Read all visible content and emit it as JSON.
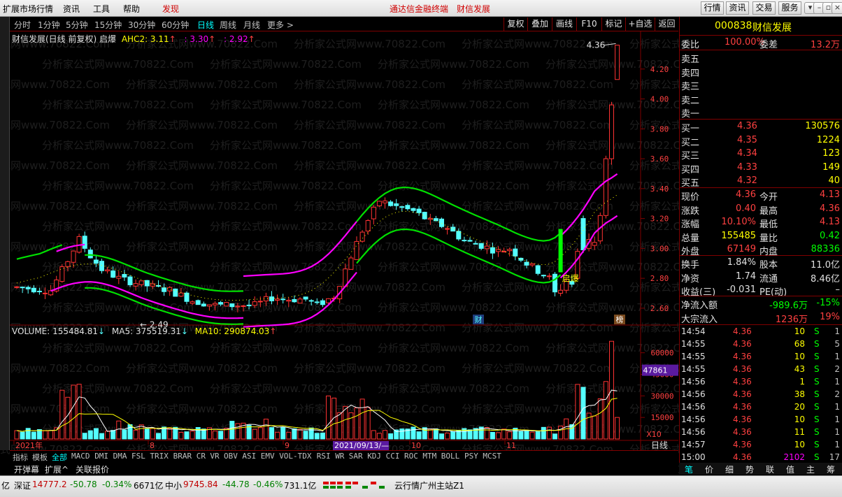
{
  "menu": {
    "items": [
      "扩展市场行情",
      "资讯",
      "工具",
      "帮助",
      "发现"
    ],
    "title_left": "通达信金融终端",
    "title_right": "财信发展",
    "right_buttons": [
      "行情",
      "资讯",
      "交易",
      "服务"
    ],
    "win_buttons": [
      "▾",
      "–",
      "▫",
      "×"
    ]
  },
  "periods": [
    "分时",
    "1分钟",
    "5分钟",
    "15分钟",
    "30分钟",
    "60分钟",
    "日线",
    "周线",
    "月线",
    "更多 >"
  ],
  "active_period": "日线",
  "toolbar": [
    "复权",
    "叠加",
    "画线",
    "F10",
    "标记",
    "+自选",
    "返回"
  ],
  "main_chart": {
    "stock_title": "财信发展(日线 前复权) 启爆",
    "ahc2_label": "AHC2: 3.11",
    "ahc2_b": ": 3.30",
    "ahc2_c": ": 2.92",
    "y_ticks": [
      "4.20",
      "4.00",
      "3.80",
      "3.60",
      "3.40",
      "3.20",
      "3.00",
      "2.80",
      "2.60"
    ],
    "high_label": "4.36",
    "low_label": "2.49",
    "signal_label": "启爆",
    "marker_cai": "财",
    "marker_bang": "榜"
  },
  "volume_chart": {
    "title": "VOLUME: 155484.81",
    "ma5": "MA5: 375519.31",
    "ma10": "MA10: 290874.03",
    "y_ticks": [
      "60000",
      "45000",
      "30000",
      "15000"
    ],
    "unit": "X10",
    "highlight": "47861"
  },
  "x_axis": {
    "labels": [
      "2021年",
      "8",
      "9",
      "2021/09/13/—",
      "10",
      "11"
    ],
    "right": "日线"
  },
  "indicator_tabs": [
    "指标",
    "模板",
    "全部",
    "MACD",
    "DMI",
    "DMA",
    "FSL",
    "TRIX",
    "BRAR",
    "CR",
    "VR",
    "OBV",
    "ASI",
    "EMV",
    "VOL-TDX",
    "RSI",
    "WR",
    "SAR",
    "KDJ",
    "CCI",
    "ROC",
    "MTM",
    "BOLL",
    "PSY",
    "MCST"
  ],
  "indicator_active": "全部",
  "bottom_tabs": [
    "开弹幕",
    "扩展^",
    "关联报价"
  ],
  "right_panel": {
    "code": "000838",
    "name": "财信发展",
    "weibi_label": "委比",
    "weibi": "100.00%",
    "weicha_label": "委差",
    "weicha": "13.2万",
    "sell_labels": [
      "卖五",
      "卖四",
      "卖三",
      "卖二",
      "卖一"
    ],
    "buy": [
      {
        "label": "买一",
        "price": "4.36",
        "vol": "130576"
      },
      {
        "label": "买二",
        "price": "4.35",
        "vol": "1224"
      },
      {
        "label": "买三",
        "price": "4.34",
        "vol": "123"
      },
      {
        "label": "买四",
        "price": "4.33",
        "vol": "149"
      },
      {
        "label": "买五",
        "price": "4.32",
        "vol": "40"
      }
    ],
    "stats": [
      {
        "l1": "现价",
        "v1": "4.36",
        "c1": "#ff4040",
        "l2": "今开",
        "v2": "4.13",
        "c2": "#ff4040"
      },
      {
        "l1": "涨跌",
        "v1": "0.40",
        "c1": "#ff4040",
        "l2": "最高",
        "v2": "4.36",
        "c2": "#ff4040"
      },
      {
        "l1": "涨幅",
        "v1": "10.10%",
        "c1": "#ff4040",
        "l2": "最低",
        "v2": "4.13",
        "c2": "#ff4040"
      },
      {
        "l1": "总量",
        "v1": "155485",
        "c1": "#ffff00",
        "l2": "量比",
        "v2": "0.42",
        "c2": "#00ff00"
      },
      {
        "l1": "外盘",
        "v1": "67149",
        "c1": "#ff4040",
        "l2": "内盘",
        "v2": "88336",
        "c2": "#00ff00"
      }
    ],
    "stats2": [
      {
        "l1": "换手",
        "v1": "1.84%",
        "l2": "股本",
        "v2": "11.0亿"
      },
      {
        "l1": "净资",
        "v1": "1.74",
        "l2": "流通",
        "v2": "8.46亿"
      },
      {
        "l1": "收益(三)",
        "v1": "-0.031",
        "l2": "PE(动)",
        "v2": "–"
      }
    ],
    "flow": [
      {
        "label": "净流入额",
        "v1": "-989.6万",
        "v2": "-15%",
        "c": "#00ff00"
      },
      {
        "label": "大宗流入",
        "v1": "1236万",
        "v2": "19%",
        "c": "#ff4040"
      }
    ],
    "ticks": [
      {
        "t": "14:54",
        "p": "4.36",
        "v": "10",
        "s": "S",
        "n": "1"
      },
      {
        "t": "14:55",
        "p": "4.36",
        "v": "68",
        "s": "S",
        "n": "5"
      },
      {
        "t": "14:55",
        "p": "4.36",
        "v": "10",
        "s": "S",
        "n": "1"
      },
      {
        "t": "14:55",
        "p": "4.36",
        "v": "43",
        "s": "S",
        "n": "2"
      },
      {
        "t": "14:56",
        "p": "4.36",
        "v": "1",
        "s": "S",
        "n": "1"
      },
      {
        "t": "14:56",
        "p": "4.36",
        "v": "38",
        "s": "S",
        "n": "2"
      },
      {
        "t": "14:56",
        "p": "4.36",
        "v": "20",
        "s": "S",
        "n": "1"
      },
      {
        "t": "14:56",
        "p": "4.36",
        "v": "10",
        "s": "S",
        "n": "1"
      },
      {
        "t": "14:56",
        "p": "4.36",
        "v": "11",
        "s": "S",
        "n": "1"
      },
      {
        "t": "14:57",
        "p": "4.36",
        "v": "10",
        "s": "S",
        "n": "1"
      },
      {
        "t": "15:00",
        "p": "4.36",
        "v": "2102",
        "s": "S",
        "n": "17"
      }
    ],
    "tabs": [
      "笔",
      "价",
      "细",
      "势",
      "联",
      "值",
      "主",
      "筹"
    ],
    "tab_active": "笔"
  },
  "status": {
    "s1": "亿",
    "s2_label": "深证",
    "s2_val": "14777.2",
    "s2_chg": "-50.78",
    "s2_pct": "-0.34%",
    "s2_amt": "6671亿",
    "s3_label": "中小",
    "s3_val": "9745.84",
    "s3_chg": "-44.78",
    "s3_pct": "-0.46%",
    "s3_amt": "731.1亿",
    "server": "云行情广州主站Z1"
  },
  "watermark": "分析家公式网www.70822.Com",
  "colors": {
    "up": "#ff3232",
    "down": "#54ffff",
    "green_line": "#00e000",
    "magenta": "#ff00ff",
    "yellow": "#ffff00"
  }
}
